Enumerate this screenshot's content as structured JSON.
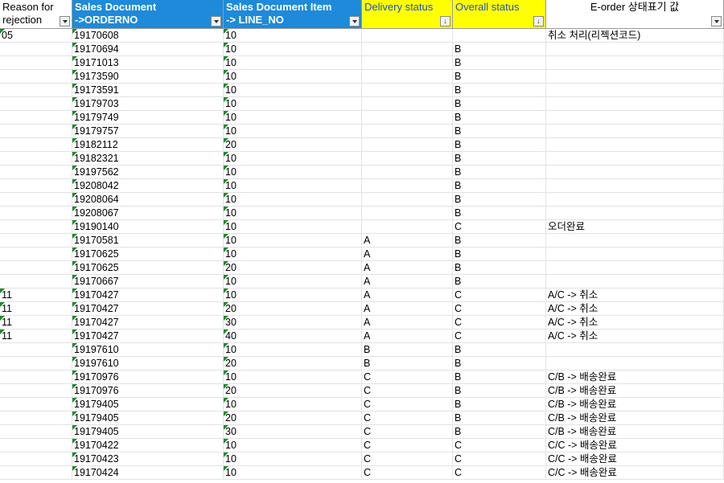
{
  "headers": [
    {
      "label": "Reason for\nrejection",
      "style": "white-left"
    },
    {
      "label": "Sales Document\n->ORDERNO",
      "style": "blue"
    },
    {
      "label": "Sales Document Item\n-> LINE_NO",
      "style": "blue"
    },
    {
      "label": "Delivery status",
      "style": "yellow"
    },
    {
      "label": "Overall status",
      "style": "yellow"
    },
    {
      "label": "E-order 상태표기 값",
      "style": "white"
    }
  ],
  "rows": [
    [
      "05",
      "19170608",
      "10",
      "",
      "",
      "취소 처리(리젝션코드)"
    ],
    [
      "",
      "19170694",
      "10",
      "",
      "B",
      ""
    ],
    [
      "",
      "19171013",
      "10",
      "",
      "B",
      ""
    ],
    [
      "",
      "19173590",
      "10",
      "",
      "B",
      ""
    ],
    [
      "",
      "19173591",
      "10",
      "",
      "B",
      ""
    ],
    [
      "",
      "19179703",
      "10",
      "",
      "B",
      ""
    ],
    [
      "",
      "19179749",
      "10",
      "",
      "B",
      ""
    ],
    [
      "",
      "19179757",
      "10",
      "",
      "B",
      ""
    ],
    [
      "",
      "19182112",
      "20",
      "",
      "B",
      ""
    ],
    [
      "",
      "19182321",
      "10",
      "",
      "B",
      ""
    ],
    [
      "",
      "19197562",
      "10",
      "",
      "B",
      ""
    ],
    [
      "",
      "19208042",
      "10",
      "",
      "B",
      ""
    ],
    [
      "",
      "19208064",
      "10",
      "",
      "B",
      ""
    ],
    [
      "",
      "19208067",
      "10",
      "",
      "B",
      ""
    ],
    [
      "",
      "19190140",
      "10",
      "",
      "C",
      "오더완료"
    ],
    [
      "",
      "19170581",
      "10",
      "A",
      "B",
      ""
    ],
    [
      "",
      "19170625",
      "10",
      "A",
      "B",
      ""
    ],
    [
      "",
      "19170625",
      "20",
      "A",
      "B",
      ""
    ],
    [
      "",
      "19170667",
      "10",
      "A",
      "B",
      ""
    ],
    [
      "11",
      "19170427",
      "10",
      "A",
      "C",
      "A/C -> 취소"
    ],
    [
      "11",
      "19170427",
      "20",
      "A",
      "C",
      "A/C -> 취소"
    ],
    [
      "11",
      "19170427",
      "30",
      "A",
      "C",
      "A/C -> 취소"
    ],
    [
      "11",
      "19170427",
      "40",
      "A",
      "C",
      "A/C -> 취소"
    ],
    [
      "",
      "19197610",
      "10",
      "B",
      "B",
      ""
    ],
    [
      "",
      "19197610",
      "20",
      "B",
      "B",
      ""
    ],
    [
      "",
      "19170976",
      "10",
      "C",
      "B",
      "C/B -> 배송완료"
    ],
    [
      "",
      "19170976",
      "20",
      "C",
      "B",
      "C/B -> 배송완료"
    ],
    [
      "",
      "19179405",
      "10",
      "C",
      "B",
      "C/B -> 배송완료"
    ],
    [
      "",
      "19179405",
      "20",
      "C",
      "B",
      "C/B -> 배송완료"
    ],
    [
      "",
      "19179405",
      "30",
      "C",
      "B",
      "C/B -> 배송완료"
    ],
    [
      "",
      "19170422",
      "10",
      "C",
      "C",
      "C/C -> 배송완료"
    ],
    [
      "",
      "19170423",
      "10",
      "C",
      "C",
      "C/C -> 배송완료"
    ],
    [
      "",
      "19170424",
      "10",
      "C",
      "C",
      "C/C -> 배송완료"
    ]
  ],
  "colors": {
    "header_blue": "#1e8ad9",
    "header_yellow": "#ffff00",
    "triangle_green": "#1f8a2d"
  },
  "filter_icons": [
    "filter-dropdown-icon",
    "filter-dropdown-icon",
    "filter-dropdown-icon",
    "filter-sorted-icon",
    "filter-sorted-icon",
    "filter-dropdown-icon"
  ]
}
